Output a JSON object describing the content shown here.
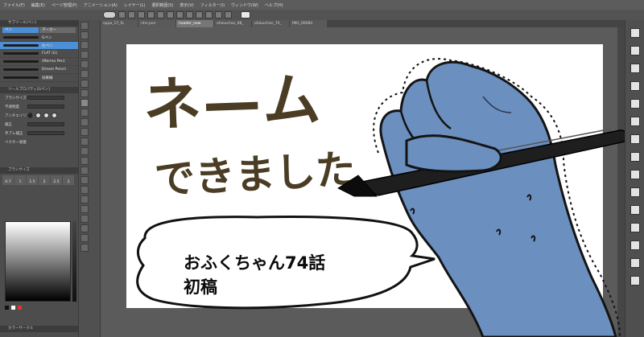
{
  "menu": [
    "ファイル(F)",
    "編集(E)",
    "ページ管理(P)",
    "アニメーション(A)",
    "レイヤー(L)",
    "選択範囲(S)",
    "表示(V)",
    "フィルター(I)",
    "ウィンドウ(W)",
    "ヘルプ(H)"
  ],
  "tabs": [
    "oppa_17_fo",
    "nhn.pen",
    "header_new",
    "ofukuchan_68_",
    "ofukuchan_74_",
    "IMG_00084"
  ],
  "brush_panel": {
    "title": "サブツール[ペン]",
    "subtabs": [
      "ペン",
      "マーカー"
    ],
    "brushes": [
      "Gペン",
      "丸ペン",
      "FLAT (G)",
      "(Marmo Pen)",
      "Dream Pencil",
      "効果線"
    ]
  },
  "tool_property": {
    "title": "ツールプロパティ[Gペン]",
    "labels": [
      "ブラシサイズ",
      "不透明度",
      "アンチエイリアス",
      "補正",
      "手ブレ補正",
      "ベクター吸着"
    ]
  },
  "brush_size_panel": {
    "title": "ブラシサイズ",
    "sizes": [
      "0.7",
      "1",
      "1.5",
      "2",
      "2.5",
      "3"
    ]
  },
  "color_panel": {
    "footer": "カラーサークル"
  },
  "canvas": {
    "handwriting_line1": "ネ—ム",
    "handwriting_line2": "できました",
    "bubble_line1": "おふくちゃん74話",
    "bubble_line2": "初稿"
  },
  "colors": {
    "hand_skin": "#6b8fbf",
    "handwriting_ink": "#4a3d24",
    "selected_item": "#4d8fd6",
    "pen_body": "#1e1e1e"
  }
}
